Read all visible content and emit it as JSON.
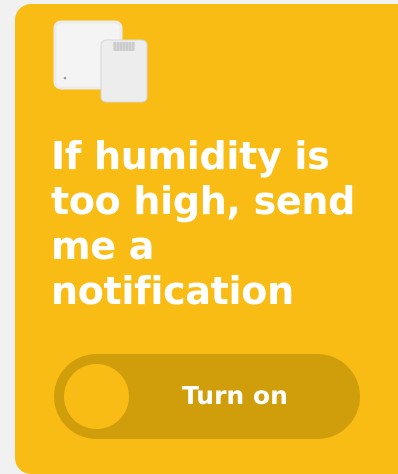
{
  "colors": {
    "card_background": "#f9bc15",
    "toggle_track": "#d09d0b",
    "toggle_knob": "#f9bc15",
    "text": "#ffffff",
    "page_background": "#f1f1f1"
  },
  "card": {
    "icon": "humidity-sensor-device-icon",
    "title": "If humidity is\ntoo high, send\nme a\nnotification",
    "toggle": {
      "label": "Turn on",
      "state": "off"
    }
  }
}
